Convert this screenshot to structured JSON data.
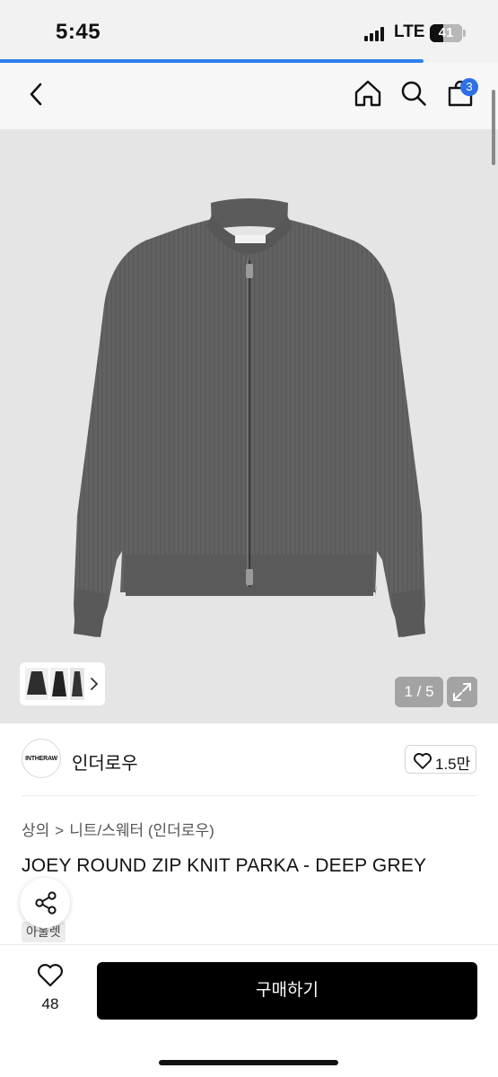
{
  "status_bar": {
    "time": "5:45",
    "network": "LTE",
    "battery_level": "41",
    "battery_fraction": 0.41
  },
  "page_load_progress": 0.85,
  "nav": {
    "back_icon": "chevron-left-icon",
    "home_icon": "home-icon",
    "search_icon": "search-icon",
    "cart_icon": "shopping-bag-icon",
    "cart_badge": "3",
    "badge_color": "#2f6fe6"
  },
  "gallery": {
    "counter": "1 / 5",
    "expand_icon": "expand-icon",
    "thumb_chevron_icon": "chevron-right-icon",
    "background": "#e5e5e5",
    "product_color": "#626262"
  },
  "brand": {
    "logo_text": "INTHERAW",
    "name": "인더로우",
    "like_icon": "heart-outline-icon",
    "like_count": "1.5만"
  },
  "breadcrumb": {
    "level1": "상의",
    "separator": ">",
    "level2": "니트/스웨터 (인더로우)"
  },
  "product": {
    "title": "JOEY ROUND ZIP KNIT PARKA - DEEP GREY"
  },
  "share": {
    "icon": "share-icon"
  },
  "tags": {
    "outlet": "아울렛"
  },
  "bottom_bar": {
    "wish_icon": "heart-outline-icon",
    "wish_count": "48",
    "buy_label": "구매하기"
  }
}
